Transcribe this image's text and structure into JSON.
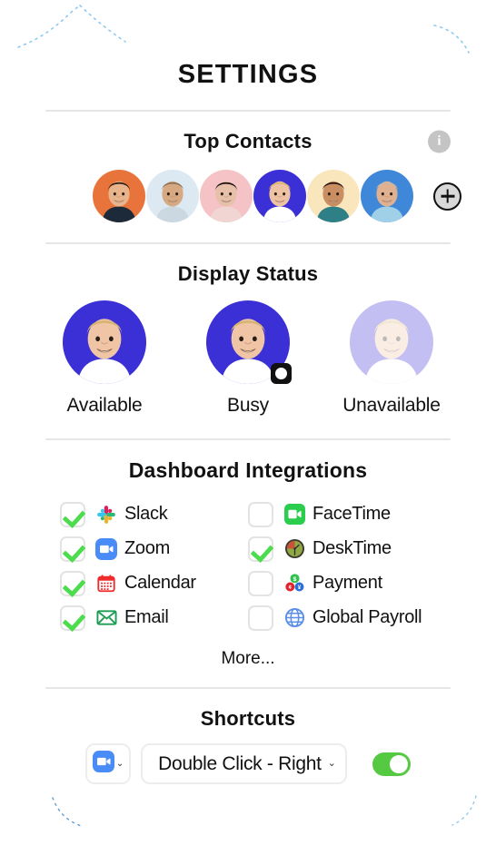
{
  "header": {
    "title": "SETTINGS"
  },
  "top_contacts": {
    "title": "Top Contacts",
    "info_icon": "info-icon",
    "info_glyph": "i",
    "add_icon": "plus-icon",
    "contacts": [
      {
        "name": "contact-1",
        "bg": "#e8743b",
        "skin": "#e8b48c",
        "hair": "#2b1b12",
        "shirt": "#1d2a3a"
      },
      {
        "name": "contact-2",
        "bg": "#dce9f2",
        "skin": "#d7a982",
        "hair": "#8a7256",
        "shirt": "#cbd8e2"
      },
      {
        "name": "contact-3",
        "bg": "#f5c3c6",
        "skin": "#e6c0a8",
        "hair": "#1a1013",
        "shirt": "#f0d5d2"
      },
      {
        "name": "contact-4",
        "bg": "#3b2fd6",
        "skin": "#edc3a4",
        "hair": "#d9b46c",
        "shirt": "#ffffff"
      },
      {
        "name": "contact-5",
        "bg": "#fae6bd",
        "skin": "#c98f63",
        "hair": "#241610",
        "shirt": "#2e7f86"
      },
      {
        "name": "contact-6",
        "bg": "#3f87d8",
        "skin": "#e0b191",
        "hair": "#c6b7a6",
        "shirt": "#9fd0e8"
      }
    ]
  },
  "display_status": {
    "title": "Display Status",
    "options": [
      {
        "label": "Available",
        "selected": false,
        "dimmed": false,
        "bg": "#3b2fd6"
      },
      {
        "label": "Busy",
        "selected": true,
        "dimmed": false,
        "bg": "#3b2fd6"
      },
      {
        "label": "Unavailable",
        "selected": false,
        "dimmed": true,
        "bg": "#3b2fd6"
      }
    ],
    "selected_badge_icon": "selected-dot-icon"
  },
  "integrations": {
    "title": "Dashboard Integrations",
    "more_label": "More...",
    "items": [
      {
        "label": "Slack",
        "checked": true,
        "icon": "slack-icon"
      },
      {
        "label": "FaceTime",
        "checked": false,
        "icon": "facetime-icon"
      },
      {
        "label": "Zoom",
        "checked": true,
        "icon": "zoom-icon"
      },
      {
        "label": "DeskTime",
        "checked": true,
        "icon": "desktime-icon"
      },
      {
        "label": "Calendar",
        "checked": true,
        "icon": "calendar-icon"
      },
      {
        "label": "Payment",
        "checked": false,
        "icon": "payment-icon"
      },
      {
        "label": "Email",
        "checked": true,
        "icon": "email-icon"
      },
      {
        "label": "Global Payroll",
        "checked": false,
        "icon": "globe-icon"
      }
    ]
  },
  "shortcuts": {
    "title": "Shortcuts",
    "app_icon": "zoom-icon",
    "app_chevron": "⌄",
    "action_value": "Double Click - Right",
    "action_chevron": "⌄",
    "toggle_on": true,
    "toggle_color": "#56c942"
  },
  "colors": {
    "accent_green": "#4ddc4d",
    "toggle_green": "#56c942",
    "divider": "#e6e6e6",
    "avatar_blue": "#3b2fd6",
    "text": "#111111",
    "info_gray": "#c4c4c4"
  }
}
